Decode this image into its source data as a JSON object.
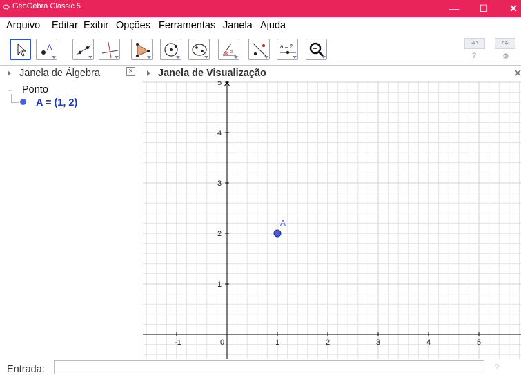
{
  "window": {
    "title": "GeoGebra Classic 5",
    "minimize": "—",
    "maximize": "☐",
    "close": "✕"
  },
  "menu": [
    "Arquivo",
    "Editar",
    "Exibir",
    "Opções",
    "Ferramentas",
    "Janela",
    "Ajuda"
  ],
  "toolbar": {
    "tools": [
      "move-icon",
      "point-icon",
      "line-icon",
      "perpendicular-line-icon",
      "polygon-icon",
      "circle-center-icon",
      "circle-three-points-icon",
      "angle-icon",
      "reflect-icon",
      "slider-icon",
      "zoom-in-icon"
    ],
    "slider_label": "a = 2",
    "angle_label": "α",
    "point_label": "A",
    "undo": "↶",
    "redo": "↷",
    "help": "?",
    "settings": "⚙"
  },
  "algebra": {
    "title": "Janela de Álgebra",
    "close": "⊠",
    "group": "Ponto",
    "collapse": "−",
    "items": [
      {
        "text": "A = (1, 2)",
        "color": "#4d5fdb"
      }
    ]
  },
  "graphics": {
    "title": "Janela de Visualização",
    "close": "✕",
    "x_ticks": [
      "-1",
      "0",
      "1",
      "2",
      "3",
      "4",
      "5"
    ],
    "y_ticks": [
      "1",
      "2",
      "3",
      "4",
      "5"
    ],
    "points": [
      {
        "label": "A",
        "x": 1,
        "y": 2,
        "color": "#4d5fdb"
      }
    ],
    "grid": true,
    "axis_color": "#000000",
    "grid_color": "#e3e3e3"
  },
  "input": {
    "label": "Entrada:",
    "value": "",
    "help": "?"
  }
}
